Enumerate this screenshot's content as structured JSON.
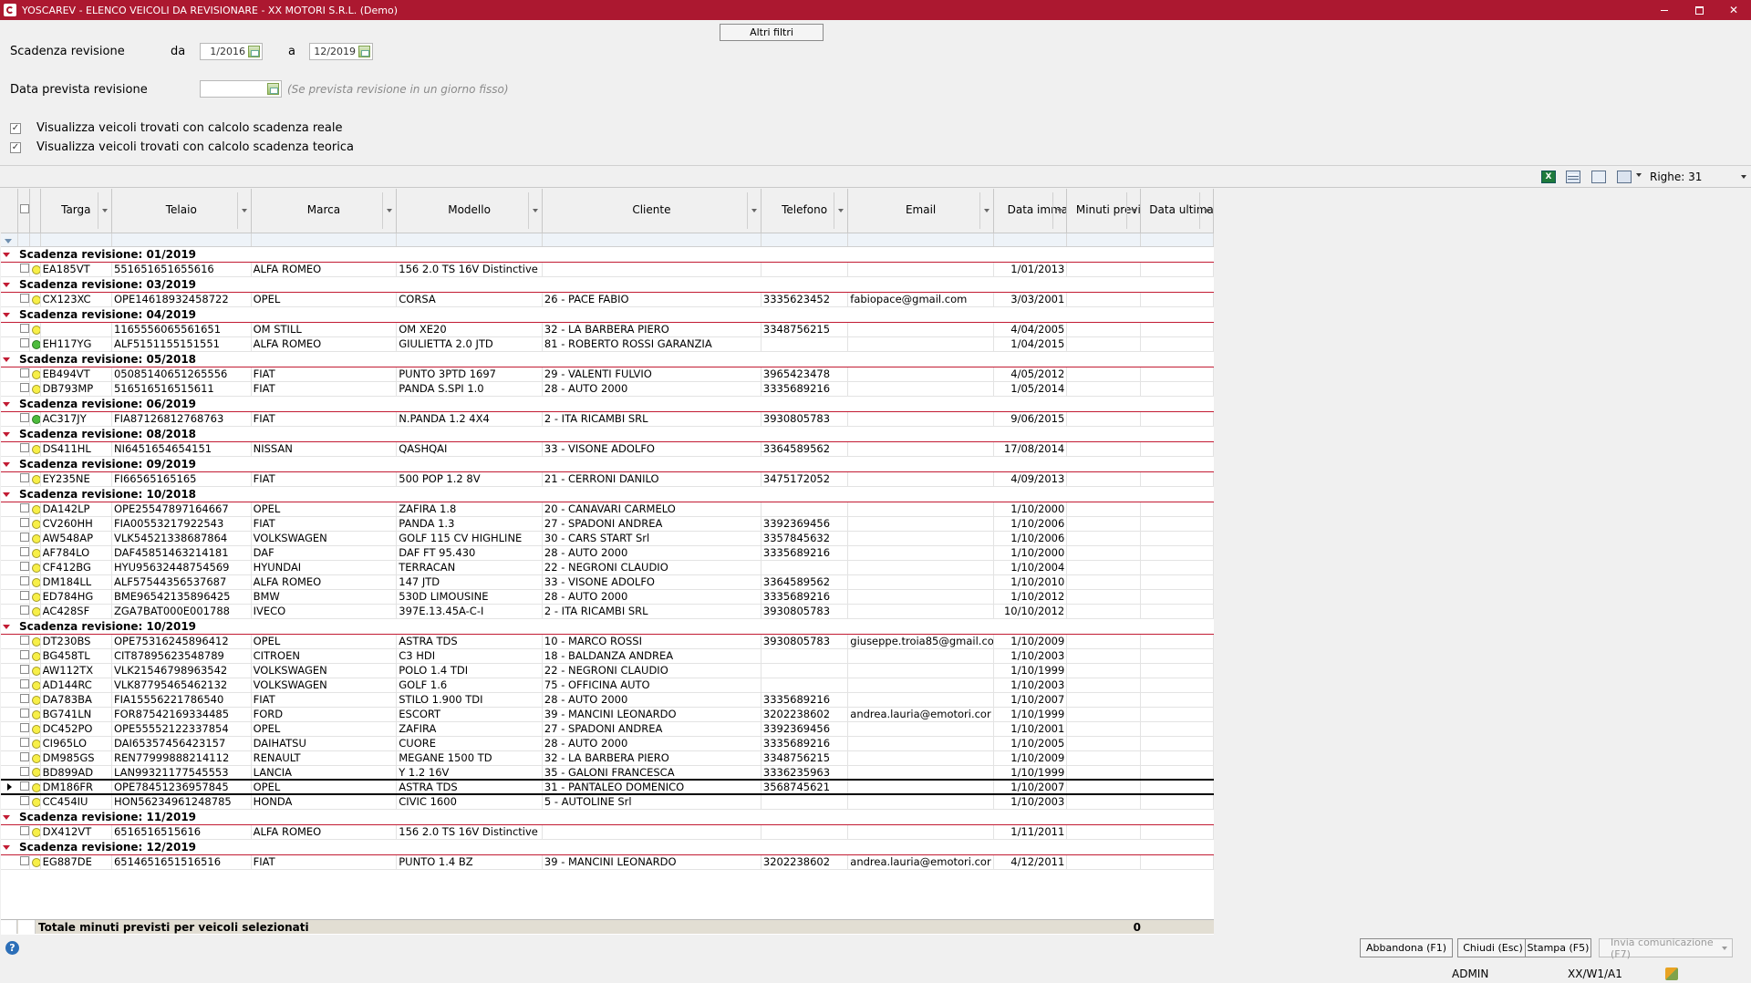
{
  "window": {
    "title": "YOSCAREV - ELENCO VEICOLI DA REVISIONARE - XX  MOTORI S.R.L.  (Demo)",
    "minimize": "",
    "maximize": "",
    "close": "✕"
  },
  "filters": {
    "altri_filtri": "Altri filtri",
    "scadenza_label": "Scadenza revisione",
    "da_label": "da",
    "da_value": "1/2016",
    "a_label": "a",
    "a_value": "12/2019",
    "data_prevista_label": "Data prevista revisione",
    "data_prevista_value": "",
    "data_prevista_hint": "(Se prevista revisione in un giorno fisso)",
    "check_reale_label": "Visualizza veicoli trovati con calcolo scadenza reale",
    "check_reale_checked": true,
    "check_teorica_label": "Visualizza veicoli trovati con calcolo scadenza teorica",
    "check_teorica_checked": true
  },
  "toolbar": {
    "excel_icon": "excel-icon",
    "grid_icon": "grid-view-icon",
    "refresh_icon": "refresh-icon",
    "columns_icon": "columns-chooser-icon",
    "xls_glyph": "X",
    "righe": "Righe: 31"
  },
  "columns": {
    "targa": "Targa",
    "telaio": "Telaio",
    "marca": "Marca",
    "modello": "Modello",
    "cliente": "Cliente",
    "telefono": "Telefono",
    "email": "Email",
    "data_immatr": "Data immatr.",
    "minuti_previsti": "Minuti previsti revisione",
    "data_ultima": "Data ultima revisione"
  },
  "groups": [
    {
      "label": "Scadenza revisione:  01/2019",
      "rows": [
        {
          "status": "yellow",
          "targa": "EA185VT",
          "telaio": "551651651655616",
          "marca": "ALFA ROMEO",
          "modello": "156 2.0 TS 16V Distinctive",
          "cliente": "",
          "telefono": "",
          "email": "",
          "data_immatr": "1/01/2013",
          "minuti": "",
          "ultima": ""
        }
      ]
    },
    {
      "label": "Scadenza revisione:  03/2019",
      "rows": [
        {
          "status": "yellow",
          "targa": "CX123XC",
          "telaio": "OPE14618932458722",
          "marca": "OPEL",
          "modello": "CORSA",
          "cliente": "26 - PACE FABIO",
          "telefono": "3335623452",
          "email": "fabiopace@gmail.com",
          "data_immatr": "3/03/2001",
          "minuti": "",
          "ultima": ""
        }
      ]
    },
    {
      "label": "Scadenza revisione:  04/2019",
      "rows": [
        {
          "status": "yellow",
          "targa": "",
          "telaio": "1165556065561651",
          "marca": "OM STILL",
          "modello": "OM XE20",
          "cliente": "32 - LA BARBERA PIERO",
          "telefono": "3348756215",
          "email": "",
          "data_immatr": "4/04/2005",
          "minuti": "",
          "ultima": ""
        },
        {
          "status": "green",
          "targa": "EH117YG",
          "telaio": "ALF5151155151551",
          "marca": "ALFA ROMEO",
          "modello": "GIULIETTA 2.0 JTD",
          "cliente": "81 - ROBERTO ROSSI GARANZIA",
          "telefono": "",
          "email": "",
          "data_immatr": "1/04/2015",
          "minuti": "",
          "ultima": ""
        }
      ]
    },
    {
      "label": "Scadenza revisione:  05/2018",
      "rows": [
        {
          "status": "yellow",
          "targa": "EB494VT",
          "telaio": "05085140651265556",
          "marca": "FIAT",
          "modello": "PUNTO 3PTD 1697",
          "cliente": "29 - VALENTI FULVIO",
          "telefono": "3965423478",
          "email": "",
          "data_immatr": "4/05/2012",
          "minuti": "",
          "ultima": ""
        },
        {
          "status": "yellow",
          "targa": "DB793MP",
          "telaio": "516516516515611",
          "marca": "FIAT",
          "modello": "PANDA S.SPI 1.0",
          "cliente": "28 - AUTO 2000",
          "telefono": "3335689216",
          "email": "",
          "data_immatr": "1/05/2014",
          "minuti": "",
          "ultima": ""
        }
      ]
    },
    {
      "label": "Scadenza revisione:  06/2019",
      "rows": [
        {
          "status": "green",
          "targa": "AC317JY",
          "telaio": "FIA87126812768763",
          "marca": "FIAT",
          "modello": "N.PANDA 1.2 4X4",
          "cliente": "2 - ITA RICAMBI SRL",
          "telefono": "3930805783",
          "email": "",
          "data_immatr": "9/06/2015",
          "minuti": "",
          "ultima": ""
        }
      ]
    },
    {
      "label": "Scadenza revisione:  08/2018",
      "rows": [
        {
          "status": "yellow",
          "targa": "DS411HL",
          "telaio": "NI6451654654151",
          "marca": "NISSAN",
          "modello": "QASHQAI",
          "cliente": "33 - VISONE ADOLFO",
          "telefono": "3364589562",
          "email": "",
          "data_immatr": "17/08/2014",
          "minuti": "",
          "ultima": ""
        }
      ]
    },
    {
      "label": "Scadenza revisione:  09/2019",
      "rows": [
        {
          "status": "yellow",
          "targa": "EY235NE",
          "telaio": "FI66565165165",
          "marca": "FIAT",
          "modello": "500 POP 1.2 8V",
          "cliente": "21 - CERRONI DANILO",
          "telefono": "3475172052",
          "email": "",
          "data_immatr": "4/09/2013",
          "minuti": "",
          "ultima": ""
        }
      ]
    },
    {
      "label": "Scadenza revisione:  10/2018",
      "rows": [
        {
          "status": "yellow",
          "targa": "DA142LP",
          "telaio": "OPE25547897164667",
          "marca": "OPEL",
          "modello": "ZAFIRA 1.8",
          "cliente": "20 - CANAVARI CARMELO",
          "telefono": "",
          "email": "",
          "data_immatr": "1/10/2000",
          "minuti": "",
          "ultima": ""
        },
        {
          "status": "yellow",
          "targa": "CV260HH",
          "telaio": "FIA00553217922543",
          "marca": "FIAT",
          "modello": "PANDA 1.3",
          "cliente": "27 - SPADONI ANDREA",
          "telefono": "3392369456",
          "email": "",
          "data_immatr": "1/10/2006",
          "minuti": "",
          "ultima": ""
        },
        {
          "status": "yellow",
          "targa": "AW548AP",
          "telaio": "VLK54521338687864",
          "marca": "VOLKSWAGEN",
          "modello": "GOLF 115 CV HIGHLINE",
          "cliente": "30 - CARS START Srl",
          "telefono": "3357845632",
          "email": "",
          "data_immatr": "1/10/2006",
          "minuti": "",
          "ultima": ""
        },
        {
          "status": "yellow",
          "targa": "AF784LO",
          "telaio": "DAF45851463214181",
          "marca": "DAF",
          "modello": "DAF FT 95.430",
          "cliente": "28 - AUTO 2000",
          "telefono": "3335689216",
          "email": "",
          "data_immatr": "1/10/2000",
          "minuti": "",
          "ultima": ""
        },
        {
          "status": "yellow",
          "targa": "CF412BG",
          "telaio": "HYU95632448754569",
          "marca": "HYUNDAI",
          "modello": "TERRACAN",
          "cliente": "22 - NEGRONI CLAUDIO",
          "telefono": "",
          "email": "",
          "data_immatr": "1/10/2004",
          "minuti": "",
          "ultima": ""
        },
        {
          "status": "yellow",
          "targa": "DM184LL",
          "telaio": "ALF57544356537687",
          "marca": "ALFA ROMEO",
          "modello": "147 JTD",
          "cliente": "33 - VISONE ADOLFO",
          "telefono": "3364589562",
          "email": "",
          "data_immatr": "1/10/2010",
          "minuti": "",
          "ultima": ""
        },
        {
          "status": "yellow",
          "targa": "ED784HG",
          "telaio": "BME96542135896425",
          "marca": "BMW",
          "modello": "530D LIMOUSINE",
          "cliente": "28 - AUTO 2000",
          "telefono": "3335689216",
          "email": "",
          "data_immatr": "1/10/2012",
          "minuti": "",
          "ultima": ""
        },
        {
          "status": "yellow",
          "targa": "AC428SF",
          "telaio": "ZGA7BAT000E001788",
          "marca": "IVECO",
          "modello": "397E.13.45A-C-I",
          "cliente": "2 - ITA RICAMBI SRL",
          "telefono": "3930805783",
          "email": "",
          "data_immatr": "10/10/2012",
          "minuti": "",
          "ultima": ""
        }
      ]
    },
    {
      "label": "Scadenza revisione:  10/2019",
      "rows": [
        {
          "status": "yellow",
          "targa": "DT230BS",
          "telaio": "OPE75316245896412",
          "marca": "OPEL",
          "modello": "ASTRA TDS",
          "cliente": "10 - MARCO ROSSI",
          "telefono": "3930805783",
          "email": "giuseppe.troia85@gmail.co",
          "data_immatr": "1/10/2009",
          "minuti": "",
          "ultima": ""
        },
        {
          "status": "yellow",
          "targa": "BG458TL",
          "telaio": "CIT87895623548789",
          "marca": "CITROEN",
          "modello": "C3 HDI",
          "cliente": "18 - BALDANZA ANDREA",
          "telefono": "",
          "email": "",
          "data_immatr": "1/10/2003",
          "minuti": "",
          "ultima": ""
        },
        {
          "status": "yellow",
          "targa": "AW112TX",
          "telaio": "VLK21546798963542",
          "marca": "VOLKSWAGEN",
          "modello": "POLO 1.4 TDI",
          "cliente": "22 - NEGRONI CLAUDIO",
          "telefono": "",
          "email": "",
          "data_immatr": "1/10/1999",
          "minuti": "",
          "ultima": ""
        },
        {
          "status": "yellow",
          "targa": "AD144RC",
          "telaio": "VLK87795465462132",
          "marca": "VOLKSWAGEN",
          "modello": "GOLF 1.6",
          "cliente": "75 - OFFICINA AUTO",
          "telefono": "",
          "email": "",
          "data_immatr": "1/10/2003",
          "minuti": "",
          "ultima": ""
        },
        {
          "status": "yellow",
          "targa": "DA783BA",
          "telaio": "FIA15556221786540",
          "marca": "FIAT",
          "modello": "STILO 1.900 TDI",
          "cliente": "28 - AUTO 2000",
          "telefono": "3335689216",
          "email": "",
          "data_immatr": "1/10/2007",
          "minuti": "",
          "ultima": ""
        },
        {
          "status": "yellow",
          "targa": "BG741LN",
          "telaio": "FOR87542169334485",
          "marca": "FORD",
          "modello": "ESCORT",
          "cliente": "39 - MANCINI LEONARDO",
          "telefono": "3202238602",
          "email": "andrea.lauria@emotori.cor",
          "data_immatr": "1/10/1999",
          "minuti": "",
          "ultima": ""
        },
        {
          "status": "yellow",
          "targa": "DC452PO",
          "telaio": "OPE55552122337854",
          "marca": "OPEL",
          "modello": "ZAFIRA",
          "cliente": "27 - SPADONI ANDREA",
          "telefono": "3392369456",
          "email": "",
          "data_immatr": "1/10/2001",
          "minuti": "",
          "ultima": ""
        },
        {
          "status": "yellow",
          "targa": "CI965LO",
          "telaio": "DAI65357456423157",
          "marca": "DAIHATSU",
          "modello": "CUORE",
          "cliente": "28 - AUTO 2000",
          "telefono": "3335689216",
          "email": "",
          "data_immatr": "1/10/2005",
          "minuti": "",
          "ultima": ""
        },
        {
          "status": "yellow",
          "targa": "DM985GS",
          "telaio": "REN77999888214112",
          "marca": "RENAULT",
          "modello": "MEGANE 1500 TD",
          "cliente": "32 - LA BARBERA PIERO",
          "telefono": "3348756215",
          "email": "",
          "data_immatr": "1/10/2009",
          "minuti": "",
          "ultima": ""
        },
        {
          "status": "yellow",
          "targa": "BD899AD",
          "telaio": "LAN99321177545553",
          "marca": "LANCIA",
          "modello": "Y 1.2 16V",
          "cliente": "35 - GALONI FRANCESCA",
          "telefono": "3336235963",
          "email": "",
          "data_immatr": "1/10/1999",
          "minuti": "",
          "ultima": ""
        },
        {
          "status": "yellow",
          "targa": "DM186FR",
          "telaio": "OPE78451236957845",
          "marca": "OPEL",
          "modello": "ASTRA TDS",
          "cliente": "31 - PANTALEO DOMENICO",
          "telefono": "3568745621",
          "email": "",
          "data_immatr": "1/10/2007",
          "minuti": "",
          "ultima": "",
          "current": true
        },
        {
          "status": "yellow",
          "targa": "CC454IU",
          "telaio": "HON56234961248785",
          "marca": "HONDA",
          "modello": "CIVIC 1600",
          "cliente": "5 - AUTOLINE Srl",
          "telefono": "",
          "email": "",
          "data_immatr": "1/10/2003",
          "minuti": "",
          "ultima": ""
        }
      ]
    },
    {
      "label": "Scadenza revisione:  11/2019",
      "rows": [
        {
          "status": "yellow",
          "targa": "DX412VT",
          "telaio": "6516516515616",
          "marca": "ALFA ROMEO",
          "modello": "156 2.0 TS 16V Distinctive",
          "cliente": "",
          "telefono": "",
          "email": "",
          "data_immatr": "1/11/2011",
          "minuti": "",
          "ultima": ""
        }
      ]
    },
    {
      "label": "Scadenza revisione:  12/2019",
      "rows": [
        {
          "status": "yellow",
          "targa": "EG887DE",
          "telaio": "6514651651516516",
          "marca": "FIAT",
          "modello": "PUNTO 1.4 BZ",
          "cliente": "39 - MANCINI LEONARDO",
          "telefono": "3202238602",
          "email": "andrea.lauria@emotori.cor",
          "data_immatr": "4/12/2011",
          "minuti": "",
          "ultima": ""
        }
      ]
    }
  ],
  "footer": {
    "totale_label": "Totale minuti previsti per veicoli selezionati",
    "totale_value": "0",
    "help_glyph": "?",
    "abbandona": "Abbandona (F1)",
    "chiudi": "Chiudi (Esc)",
    "stampa": "Stampa (F5)",
    "invia": "Invia comunicazione (F7)",
    "user": "ADMIN",
    "ws": "XX/W1/A1"
  },
  "colors": {
    "titlebar": "#ac1830",
    "group_line": "#c21b33",
    "status_yellow": "#f7ef48",
    "status_green": "#4dbb3c"
  }
}
